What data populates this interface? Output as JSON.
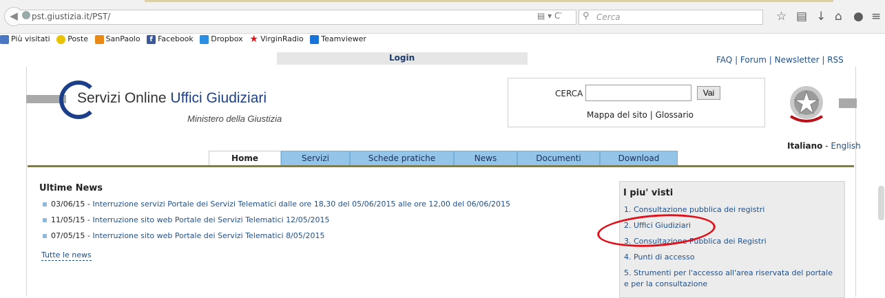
{
  "browser": {
    "url": "pst.giustizia.it/PST/",
    "search_placeholder": "Cerca",
    "bookmarks": [
      {
        "label": "Più visitati",
        "icon": "firefox-icon",
        "color": "#4a78c2"
      },
      {
        "label": "Poste",
        "icon": "poste-icon",
        "color": "#e9c200"
      },
      {
        "label": "SanPaolo",
        "icon": "sanpaolo-icon",
        "color": "#e98a18"
      },
      {
        "label": "Facebook",
        "icon": "facebook-icon",
        "color": "#3b5998"
      },
      {
        "label": "Dropbox",
        "icon": "dropbox-icon",
        "color": "#2c8ee0"
      },
      {
        "label": "VirginRadio",
        "icon": "star-icon",
        "color": "#d8171b"
      },
      {
        "label": "Teamviewer",
        "icon": "teamviewer-icon",
        "color": "#1a73d6"
      }
    ]
  },
  "header": {
    "login": "Login",
    "faq": "FAQ",
    "forum": "Forum",
    "newsletter": "Newsletter",
    "rss": "RSS",
    "logo_servizi": "Servizi Online",
    "logo_uffici": "Uffici Giudiziari",
    "ministero": "Ministero della Giustizia",
    "cerca_label": "CERCA",
    "vai": "Vai",
    "mappa": "Mappa del sito",
    "glossario": "Glossario",
    "lang_it": "Italiano",
    "lang_en": "English"
  },
  "tabs": [
    "Home",
    "Servizi",
    "Schede pratiche",
    "News",
    "Documenti",
    "Download"
  ],
  "news": {
    "title": "Ultime News",
    "items": [
      {
        "date": "03/06/15",
        "text": "Interruzione servizi Portale dei Servizi Telematici dalle ore 18,30 del 05/06/2015 alle ore 12,00 del 06/06/2015"
      },
      {
        "date": "11/05/15",
        "text": "Interruzione sito web Portale dei Servizi Telematici 12/05/2015"
      },
      {
        "date": "07/05/15",
        "text": "Interruzione sito web Portale dei Servizi Telematici 8/05/2015"
      }
    ],
    "all": "Tutte le news"
  },
  "most_viewed": {
    "title": "I piu' visti",
    "items": [
      "1. Consultazione pubblica dei registri",
      "2. Uffici Giudiziari",
      "3. Consultazione Pubblica dei Registri",
      "4. Punti di accesso",
      "5. Strumenti per l'accesso all'area riservata del portale e per la consultazione"
    ]
  },
  "colors": {
    "highlight": "#e0101a",
    "tab": "#94c5e8",
    "link": "#1f4f8a"
  }
}
